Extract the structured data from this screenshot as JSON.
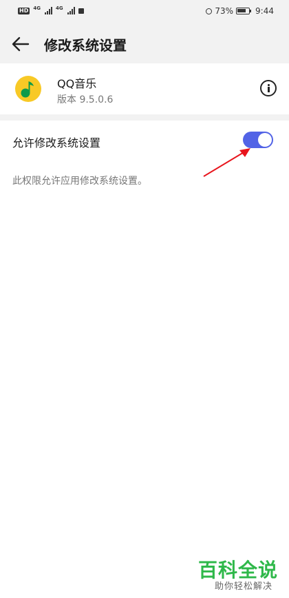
{
  "status_bar": {
    "left_badge": "HD",
    "signal1_label": "4G",
    "signal2_label": "4G",
    "battery_percent": "73%",
    "time": "9:44"
  },
  "header": {
    "title": "修改系统设置"
  },
  "app": {
    "name": "QQ音乐",
    "version": "版本 9.5.0.6"
  },
  "setting": {
    "label": "允许修改系统设置",
    "enabled": true,
    "description": "此权限允许应用修改系统设置。"
  },
  "watermark": {
    "title": "百科全说",
    "subtitle": "助你轻松解决"
  },
  "colors": {
    "toggle_on": "#5263e6",
    "app_logo_bg": "#f8c926",
    "app_logo_note": "#0e9a4a",
    "arrow": "#e8141c",
    "watermark": "#2fb84a"
  }
}
